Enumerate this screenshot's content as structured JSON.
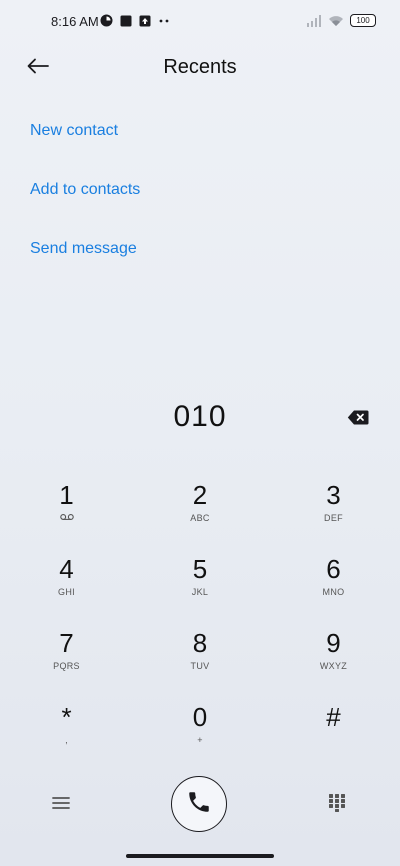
{
  "status_bar": {
    "time": "8:16 AM",
    "battery": "100",
    "left_icons": [
      "record-icon",
      "square-icon",
      "upload-icon",
      "more-dots-icon"
    ],
    "right_icons": [
      "signal-icon",
      "wifi-icon",
      "battery-icon"
    ]
  },
  "header": {
    "title": "Recents",
    "back_icon": "arrow-left-icon"
  },
  "actions": {
    "new_contact": "New contact",
    "add_to_contacts": "Add to contacts",
    "send_message": "Send message"
  },
  "dialer": {
    "number": "010",
    "backspace_icon": "backspace-icon"
  },
  "keypad": {
    "keys": [
      {
        "digit": "1",
        "sub": ""
      },
      {
        "digit": "2",
        "sub": "ABC"
      },
      {
        "digit": "3",
        "sub": "DEF"
      },
      {
        "digit": "4",
        "sub": "GHI"
      },
      {
        "digit": "5",
        "sub": "JKL"
      },
      {
        "digit": "6",
        "sub": "MNO"
      },
      {
        "digit": "7",
        "sub": "PQRS"
      },
      {
        "digit": "8",
        "sub": "TUV"
      },
      {
        "digit": "9",
        "sub": "WXYZ"
      },
      {
        "digit": "*",
        "sub": ","
      },
      {
        "digit": "0",
        "sub": "+"
      },
      {
        "digit": "#",
        "sub": ""
      }
    ]
  },
  "bottom_bar": {
    "menu_icon": "menu-icon",
    "call_icon": "phone-icon",
    "dialpad_icon": "dialpad-icon"
  },
  "colors": {
    "accent": "#1a7fe0",
    "text": "#1b1b1f"
  }
}
